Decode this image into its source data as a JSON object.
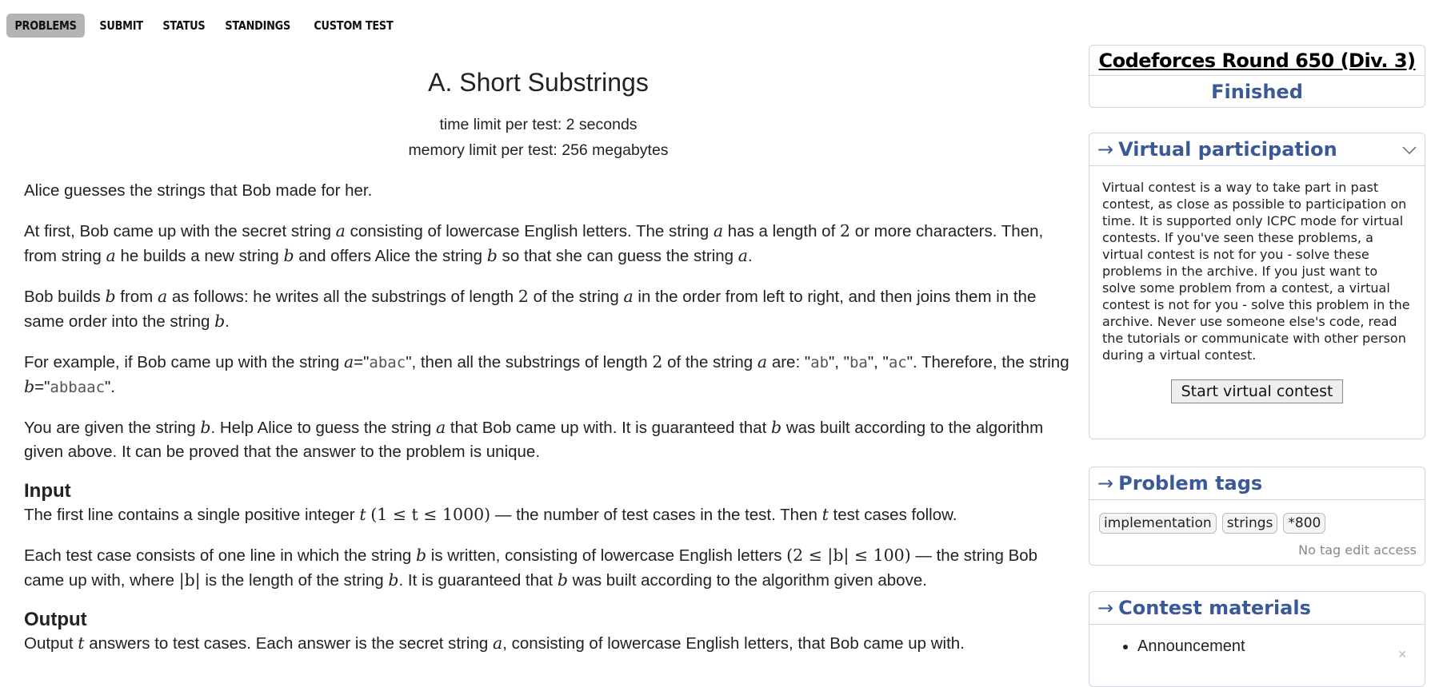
{
  "nav": {
    "tabs": [
      "PROBLEMS",
      "SUBMIT",
      "STATUS",
      "STANDINGS",
      "CUSTOM TEST"
    ]
  },
  "problem": {
    "title": "A. Short Substrings",
    "time_limit": "time limit per test: 2 seconds",
    "memory_limit": "memory limit per test: 256 megabytes",
    "p1": "Alice guesses the strings that Bob made for her.",
    "p2": {
      "t1": "At first, Bob came up with the secret string ",
      "v1": "a",
      "t2": " consisting of lowercase English letters. The string ",
      "v2": "a",
      "t3": " has a length of ",
      "n1": "2",
      "t4": " or more characters. Then, from string ",
      "v3": "a",
      "t5": " he builds a new string ",
      "v4": "b",
      "t6": " and offers Alice the string ",
      "v5": "b",
      "t7": " so that she can guess the string ",
      "v6": "a",
      "t8": "."
    },
    "p3": {
      "t1": "Bob builds ",
      "v1": "b",
      "t2": " from ",
      "v2": "a",
      "t3": " as follows: he writes all the substrings of length ",
      "n1": "2",
      "t4": " of the string ",
      "v3": "a",
      "t5": " in the order from left to right, and then joins them in the same order into the string ",
      "v4": "b",
      "t6": "."
    },
    "p4": {
      "t1": "For example, if Bob came up with the string ",
      "v1": "a",
      "t2": "=\"",
      "c1": "abac",
      "t3": "\", then all the substrings of length ",
      "n1": "2",
      "t4": " of the string ",
      "v2": "a",
      "t5": " are: \"",
      "c2": "ab",
      "t6": "\", \"",
      "c3": "ba",
      "t7": "\", \"",
      "c4": "ac",
      "t8": "\". Therefore, the string ",
      "v3": "b",
      "t9": "=\"",
      "c5": "abbaac",
      "t10": "\"."
    },
    "p5": {
      "t1": "You are given the string ",
      "v1": "b",
      "t2": ". Help Alice to guess the string ",
      "v2": "a",
      "t3": " that Bob came up with. It is guaranteed that ",
      "v3": "b",
      "t4": " was built according to the algorithm given above. It can be proved that the answer to the problem is unique."
    },
    "input_title": "Input",
    "input1": {
      "t1": "The first line contains a single positive integer ",
      "v1": "t",
      "t2": " ",
      "math": "(1 ≤ t ≤ 1000)",
      "t3": " — the number of test cases in the test. Then ",
      "v2": "t",
      "t4": " test cases follow."
    },
    "input2": {
      "t1": "Each test case consists of one line in which the string ",
      "v1": "b",
      "t2": " is written, consisting of lowercase English letters ",
      "math": "(2 ≤ |b| ≤ 100)",
      "t3": " — the string Bob came up with, where ",
      "math2": "|b|",
      "t4": " is the length of the string ",
      "v2": "b",
      "t5": ". It is guaranteed that ",
      "v3": "b",
      "t6": " was built according to the algorithm given above."
    },
    "output_title": "Output",
    "output1": {
      "t1": "Output ",
      "v1": "t",
      "t2": " answers to test cases. Each answer is the secret string ",
      "v2": "a",
      "t3": ", consisting of lowercase English letters, that Bob came up with."
    }
  },
  "sidebar": {
    "contest_name": "Codeforces Round 650 (Div. 3)",
    "contest_status": "Finished",
    "virtual": {
      "title": "Virtual participation",
      "text": "Virtual contest is a way to take part in past contest, as close as possible to participation on time. It is supported only ICPC mode for virtual contests. If you've seen these problems, a virtual contest is not for you - solve these problems in the archive. If you just want to solve some problem from a contest, a virtual contest is not for you - solve this problem in the archive. Never use someone else's code, read the tutorials or communicate with other person during a virtual contest.",
      "button": "Start virtual contest"
    },
    "tags": {
      "title": "Problem tags",
      "items": [
        "implementation",
        "strings",
        "*800"
      ],
      "note": "No tag edit access"
    },
    "materials": {
      "title": "Contest materials",
      "items": [
        "Announcement"
      ]
    },
    "arrow": "→"
  }
}
